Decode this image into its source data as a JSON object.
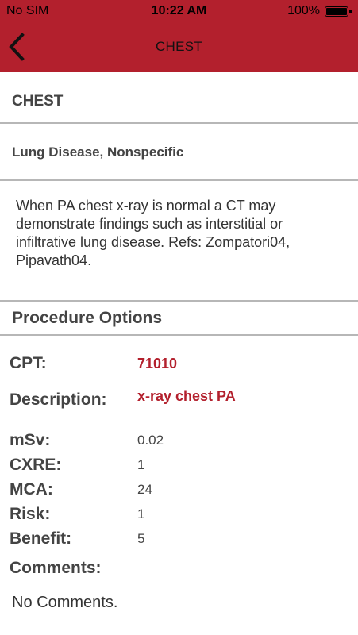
{
  "status_bar": {
    "carrier": "No SIM",
    "time": "10:22 AM",
    "battery_percent": "100%",
    "battery_icon": "battery-full-icon"
  },
  "nav": {
    "title": "CHEST",
    "back_icon": "chevron-left-icon"
  },
  "section": {
    "title": "CHEST",
    "subtitle": "Lung Disease, Nonspecific",
    "summary": "When PA chest x-ray is normal a CT may demonstrate findings such as interstitial or infiltrative lung disease. Refs: Zompatori04, Pipavath04."
  },
  "procedure": {
    "header": "Procedure Options",
    "cpt_label": "CPT:",
    "cpt_value": "71010",
    "description_label": "Description:",
    "description_value": "x-ray chest PA",
    "msv_label": "mSv:",
    "msv_value": "0.02",
    "cxre_label": "CXRE:",
    "cxre_value": "1",
    "mca_label": "MCA:",
    "mca_value": "24",
    "risk_label": "Risk:",
    "risk_value": "1",
    "benefit_label": "Benefit:",
    "benefit_value": "5",
    "comments_label": "Comments:",
    "comments_value": "No Comments."
  },
  "colors": {
    "brand_red": "#b3202d",
    "divider": "#b7b7b7"
  }
}
